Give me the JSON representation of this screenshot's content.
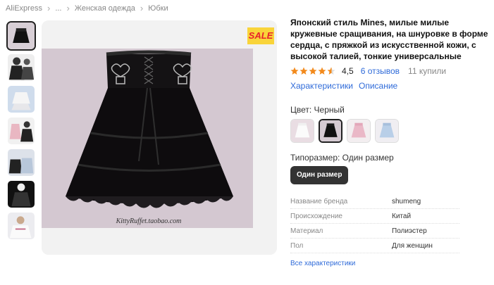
{
  "breadcrumb": {
    "items": [
      "AliExpress",
      "...",
      "Женская одежда",
      "Юбки"
    ],
    "separator": ">"
  },
  "gallery": {
    "thumbnails": [
      "thumb-1",
      "thumb-2",
      "thumb-3",
      "thumb-4",
      "thumb-5",
      "thumb-6",
      "thumb-7"
    ],
    "selected_index": 0,
    "watermark": "KittyRuffet.taobao.com",
    "sale_badge": "SALE"
  },
  "product": {
    "title": "Японский стиль Mines, милые милые кружевные сращивания, на шнуровке в форме сердца, с пряжкой из искусственной кожи, с высокой талией, тонкие универсальные короткие юбки трапециевидной формы в стиле Лолиты для",
    "rating": "4,5",
    "rating_stars": 4.5,
    "reviews": "6 отзывов",
    "sold": "11 купили",
    "tabs": [
      "Характеристики",
      "Описание"
    ]
  },
  "options": {
    "color_label": "Цвет: Черный",
    "color_swatches": [
      "white",
      "black",
      "pink",
      "blue"
    ],
    "color_selected_index": 1,
    "size_label": "Типоразмер: Один размер",
    "size_button": "Один размер"
  },
  "specs": [
    {
      "key": "Название бренда",
      "value": "shumeng"
    },
    {
      "key": "Происхождение",
      "value": "Китай"
    },
    {
      "key": "Материал",
      "value": "Полиэстер"
    },
    {
      "key": "Пол",
      "value": "Для женщин"
    }
  ],
  "all_specs_link": "Все характеристики",
  "colors": {
    "link": "#2f6bd9",
    "star": "#f28a1c",
    "sale_bg": "#f9d43a",
    "sale_text": "#e8232a",
    "size_button_bg": "#333333"
  }
}
